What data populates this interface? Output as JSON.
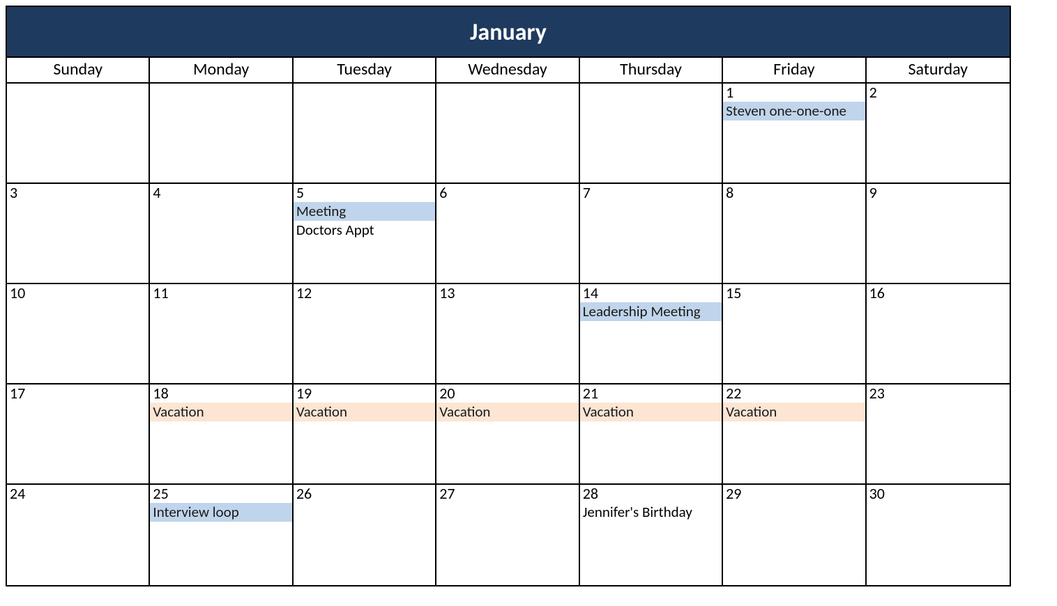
{
  "month": "January",
  "dayNames": [
    "Sunday",
    "Monday",
    "Tuesday",
    "Wednesday",
    "Thursday",
    "Friday",
    "Saturday"
  ],
  "weeks": [
    [
      {
        "number": "",
        "events": []
      },
      {
        "number": "",
        "events": []
      },
      {
        "number": "",
        "events": []
      },
      {
        "number": "",
        "events": []
      },
      {
        "number": "",
        "events": []
      },
      {
        "number": "1",
        "events": [
          {
            "label": "Steven one-one-one",
            "color": "blue"
          }
        ]
      },
      {
        "number": "2",
        "events": []
      }
    ],
    [
      {
        "number": "3",
        "events": []
      },
      {
        "number": "4",
        "events": []
      },
      {
        "number": "5",
        "events": [
          {
            "label": "Meeting",
            "color": "blue"
          },
          {
            "label": "Doctors Appt",
            "color": "plain"
          }
        ]
      },
      {
        "number": "6",
        "events": []
      },
      {
        "number": "7",
        "events": []
      },
      {
        "number": "8",
        "events": []
      },
      {
        "number": "9",
        "events": []
      }
    ],
    [
      {
        "number": "10",
        "events": []
      },
      {
        "number": "11",
        "events": []
      },
      {
        "number": "12",
        "events": []
      },
      {
        "number": "13",
        "events": []
      },
      {
        "number": "14",
        "events": [
          {
            "label": "Leadership Meeting",
            "color": "blue"
          }
        ]
      },
      {
        "number": "15",
        "events": []
      },
      {
        "number": "16",
        "events": []
      }
    ],
    [
      {
        "number": "17",
        "events": []
      },
      {
        "number": "18",
        "events": [
          {
            "label": "Vacation",
            "color": "orange"
          }
        ]
      },
      {
        "number": "19",
        "events": [
          {
            "label": "Vacation",
            "color": "orange"
          }
        ]
      },
      {
        "number": "20",
        "events": [
          {
            "label": "Vacation",
            "color": "orange"
          }
        ]
      },
      {
        "number": "21",
        "events": [
          {
            "label": "Vacation",
            "color": "orange"
          }
        ]
      },
      {
        "number": "22",
        "events": [
          {
            "label": "Vacation",
            "color": "orange"
          }
        ]
      },
      {
        "number": "23",
        "events": []
      }
    ],
    [
      {
        "number": "24",
        "events": []
      },
      {
        "number": "25",
        "events": [
          {
            "label": "Interview loop",
            "color": "blue"
          }
        ]
      },
      {
        "number": "26",
        "events": []
      },
      {
        "number": "27",
        "events": []
      },
      {
        "number": "28",
        "events": [
          {
            "label": "Jennifer's Birthday",
            "color": "plain"
          }
        ]
      },
      {
        "number": "29",
        "events": []
      },
      {
        "number": "30",
        "events": []
      }
    ]
  ]
}
